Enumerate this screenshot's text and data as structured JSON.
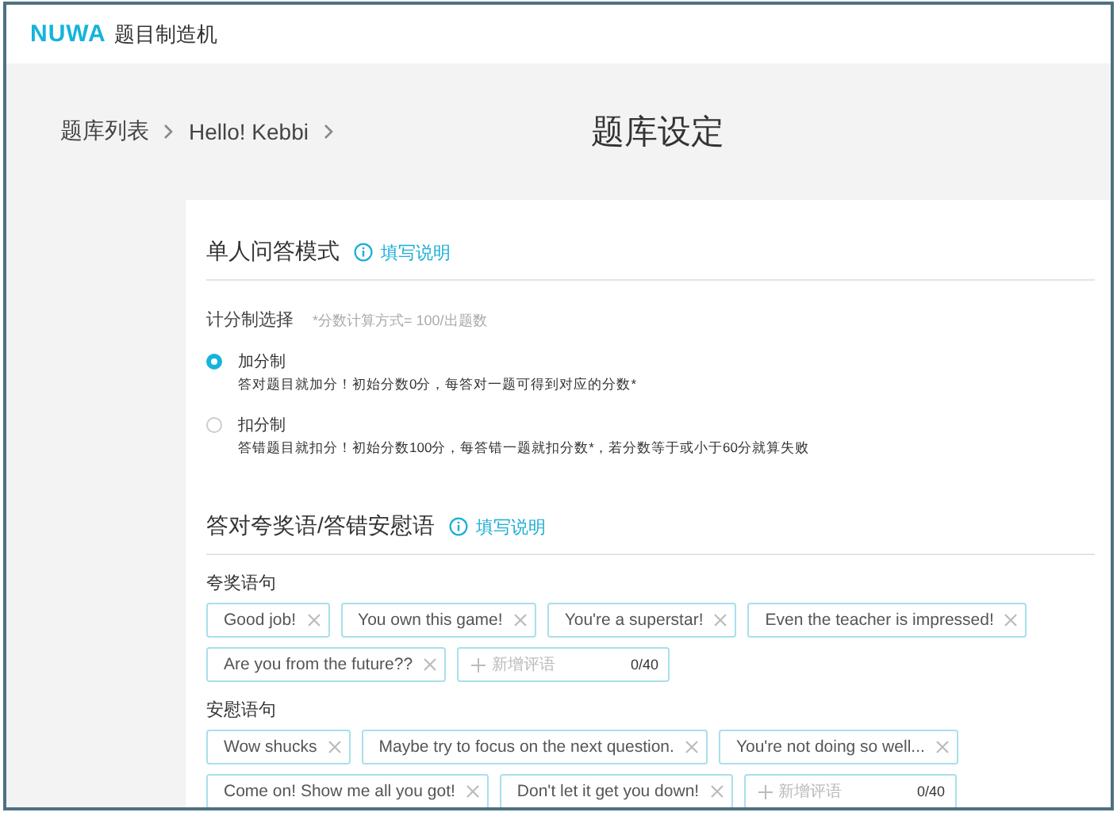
{
  "header": {
    "logo": "NUWA",
    "app_name": "题目制造机"
  },
  "breadcrumb": [
    {
      "label": "题库列表"
    },
    {
      "label": "Hello! Kebbi"
    }
  ],
  "page_title": "题库设定",
  "sections": [
    {
      "kind": "scoring",
      "title": "单人问答模式",
      "help_link": "填写说明",
      "field_label": "计分制选择",
      "note": "*分数计算方式= 100/出题数",
      "options": [
        {
          "label": "加分制",
          "description": "答对题目就加分！初始分数0分，每答对一题可得到对应的分数*",
          "selected": true
        },
        {
          "label": "扣分制",
          "description": "答错题目就扣分！初始分数100分，每答错一题就扣分数*，若分数等于或小于60分就算失败",
          "selected": false
        }
      ]
    },
    {
      "kind": "phrases",
      "title": "答对夸奖语/答错安慰语",
      "help_link": "填写说明",
      "groups": [
        {
          "label": "夸奖语句",
          "tags": [
            "Good job!",
            "You own this game!",
            "You're a superstar!",
            "Even the teacher is impressed!",
            "Are you from the future??"
          ],
          "new_field": {
            "placeholder": "新增评语",
            "counter": "0/40"
          }
        },
        {
          "label": "安慰语句",
          "tags": [
            "Wow shucks",
            "Maybe try to focus on the next question.",
            "You're not doing so well...",
            "Come on! Show me all you got!",
            "Don't let it get you down!"
          ],
          "new_field": {
            "placeholder": "新增评语",
            "counter": "0/40"
          }
        }
      ]
    }
  ]
}
